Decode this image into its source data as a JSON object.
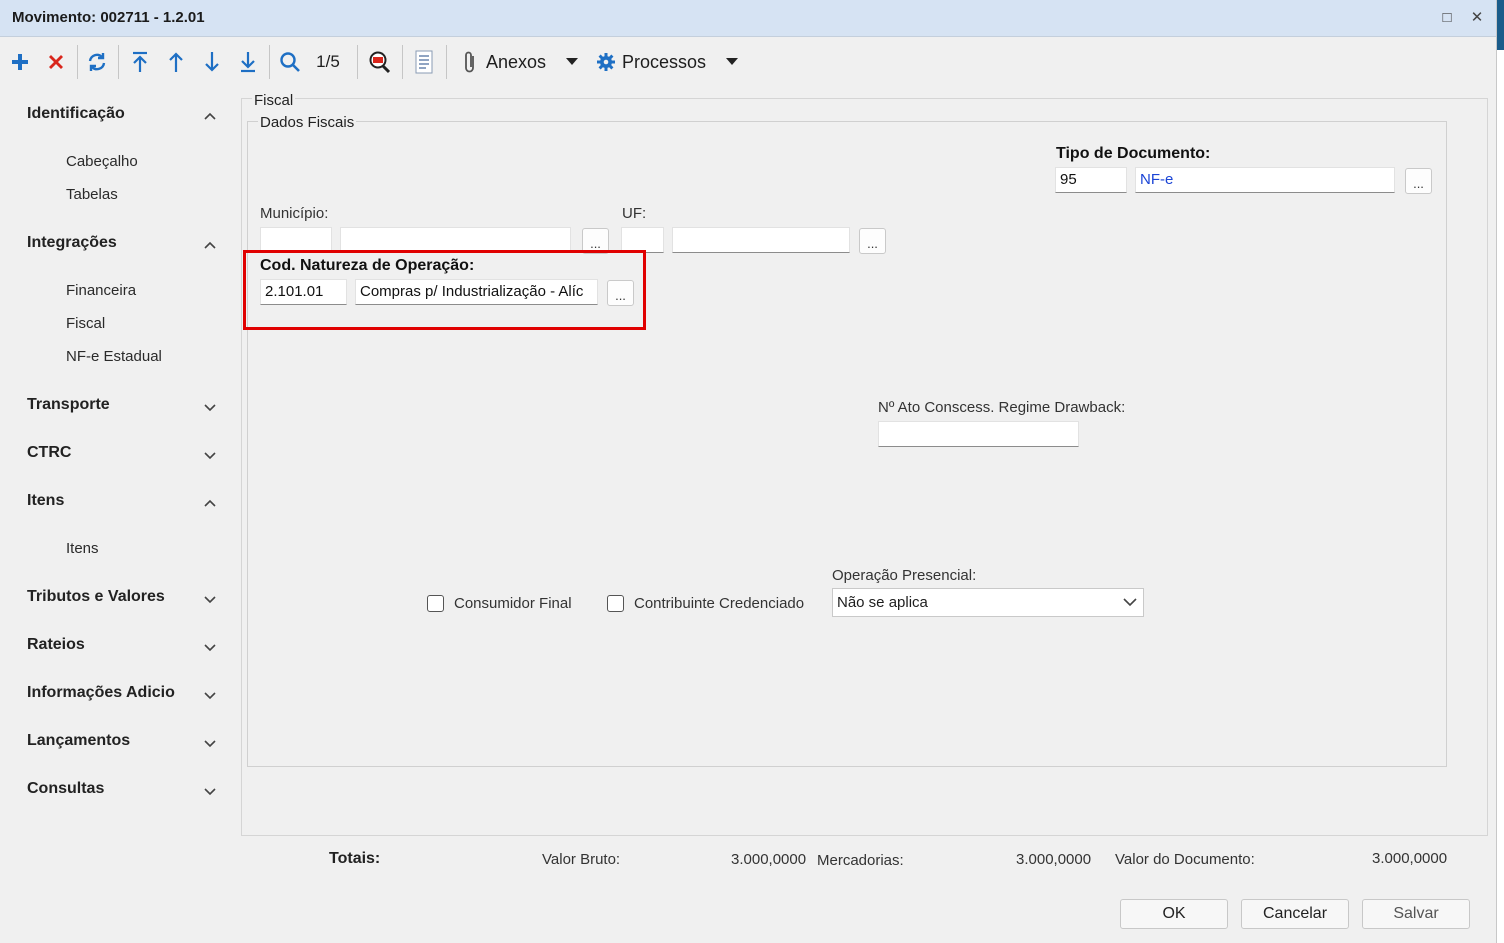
{
  "window": {
    "title": "Movimento: 002711 - 1.2.01",
    "maximize_icon": "□",
    "close_icon": "✕"
  },
  "toolbar": {
    "counter": "1/5",
    "anexos_label": "Anexos",
    "processos_label": "Processos",
    "accent_blue": "#1e6fc4",
    "accent_red": "#d9261c"
  },
  "nav": {
    "sections": [
      {
        "label": "Identificação",
        "expanded": true,
        "items": [
          "Cabeçalho",
          "Tabelas"
        ]
      },
      {
        "label": "Integrações",
        "expanded": true,
        "items": [
          "Financeira",
          "Fiscal",
          "NF-e Estadual"
        ]
      },
      {
        "label": "Transporte",
        "expanded": false
      },
      {
        "label": "CTRC",
        "expanded": false
      },
      {
        "label": "Itens",
        "expanded": true,
        "items": [
          "Itens"
        ]
      },
      {
        "label": "Tributos e Valores",
        "expanded": false
      },
      {
        "label": "Rateios",
        "expanded": false
      },
      {
        "label": "Informações Adicio",
        "expanded": false
      },
      {
        "label": "Lançamentos",
        "expanded": false
      },
      {
        "label": "Consultas",
        "expanded": false
      }
    ]
  },
  "form": {
    "group_title": "Fiscal",
    "subgroup_title": "Dados Fiscais",
    "tipo_documento": {
      "label": "Tipo de Documento:",
      "code": "95",
      "description": "NF-e"
    },
    "municipio": {
      "label": "Município:",
      "code": "",
      "name": ""
    },
    "uf": {
      "label": "UF:",
      "code": "",
      "name": ""
    },
    "natureza": {
      "label": "Cod. Natureza de Operação:",
      "code": "2.101.01",
      "description": "Compras p/ Industrialização - Alíc"
    },
    "drawback": {
      "label": "Nº Ato Conscess. Regime Drawback:",
      "value": ""
    },
    "consumidor_final": {
      "label": "Consumidor Final",
      "checked": false
    },
    "contribuinte": {
      "label": "Contribuinte Credenciado",
      "checked": false
    },
    "operacao_presencial": {
      "label": "Operação Presencial:",
      "value": "Não se aplica"
    },
    "ellipsis": "..."
  },
  "totals": {
    "title": "Totais:",
    "valor_bruto_label": "Valor Bruto:",
    "valor_bruto": "3.000,0000",
    "mercadorias_label": "Mercadorias:",
    "mercadorias": "3.000,0000",
    "valor_documento_label": "Valor do Documento:",
    "valor_documento": "3.000,0000"
  },
  "buttons": {
    "ok": "OK",
    "cancel": "Cancelar",
    "save": "Salvar"
  },
  "highlight_color": "#e00000"
}
